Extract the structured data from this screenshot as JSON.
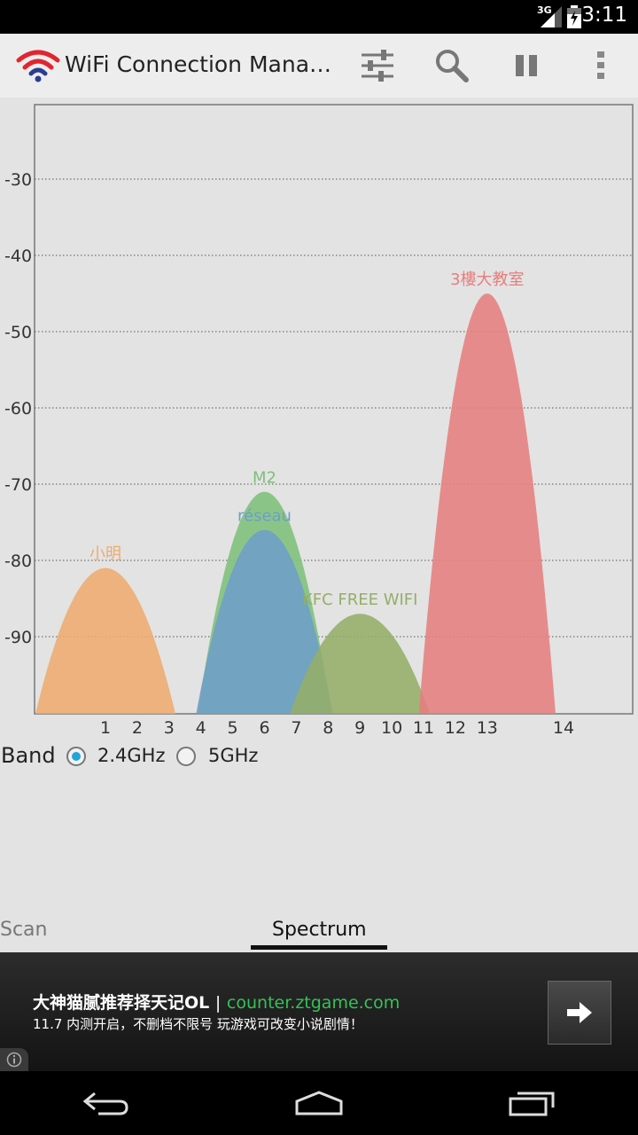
{
  "status_bar": {
    "time": "3:11",
    "network": "3G"
  },
  "action_bar": {
    "title": "WiFi Connection Mana…",
    "icons": [
      "wifi-logo-icon",
      "filter-sliders-icon",
      "search-icon",
      "pause-icon",
      "overflow-menu-icon"
    ]
  },
  "chart_data": {
    "type": "area",
    "y_ticks": [
      -30,
      -40,
      -50,
      -60,
      -70,
      -80,
      -90
    ],
    "x_ticks": [
      1,
      2,
      3,
      4,
      5,
      6,
      7,
      8,
      9,
      10,
      11,
      12,
      13,
      14
    ],
    "ylim": [
      -100,
      -20
    ],
    "grid": true,
    "networks": [
      {
        "name": "小明",
        "channel": 1,
        "level": -81,
        "width": 4.4,
        "color": "#eeab6e"
      },
      {
        "name": "M2",
        "channel": 6,
        "level": -71,
        "width": 4.2,
        "color": "#7dc07a"
      },
      {
        "name": "réseau",
        "channel": 6,
        "level": -76,
        "width": 4.3,
        "color": "#6e9ec9"
      },
      {
        "name": "KFC FREE WIFI",
        "channel": 9,
        "level": -87,
        "width": 4.4,
        "color": "#94ae68"
      },
      {
        "name": "3樓大教室",
        "channel": 13,
        "level": -45,
        "width": 4.3,
        "color": "#e67e7e"
      }
    ]
  },
  "band": {
    "label": "Band",
    "options": [
      "2.4GHz",
      "5GHz"
    ],
    "selected": "2.4GHz"
  },
  "tabs": [
    {
      "label": "Scan",
      "active": false
    },
    {
      "label": "Spectrum",
      "active": true
    }
  ],
  "ad": {
    "title": "大神猫腻推荐择天记OL",
    "separator": "|",
    "url": "counter.ztgame.com",
    "description": "11.7 内测开启，不删档不限号 玩游戏可改变小说剧情！"
  }
}
